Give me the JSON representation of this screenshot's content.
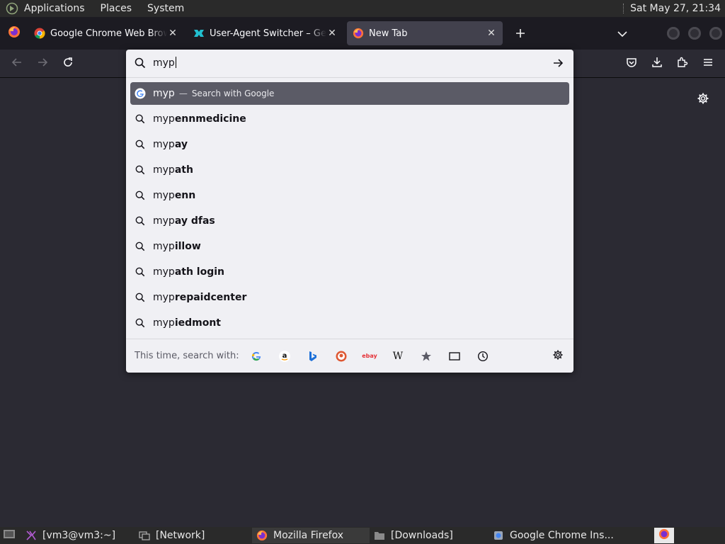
{
  "topbar": {
    "menus": [
      "Applications",
      "Places",
      "System"
    ],
    "clock": "Sat May 27, 21:34"
  },
  "tabs": [
    {
      "title": "Google Chrome Web Browser",
      "icon": "chrome-icon"
    },
    {
      "title": "User-Agent Switcher – Get this Extension for Firefox",
      "icon": "extension-icon"
    },
    {
      "title": "New Tab",
      "icon": "firefox-icon"
    }
  ],
  "urlbar": {
    "value": "myp"
  },
  "suggestions": [
    {
      "prefix": "myp",
      "rest": "",
      "dash": "—",
      "action": "Search with Google",
      "icon": "google-icon"
    },
    {
      "prefix": "myp",
      "rest": "ennmedicine"
    },
    {
      "prefix": "myp",
      "rest": "ay"
    },
    {
      "prefix": "myp",
      "rest": "ath"
    },
    {
      "prefix": "myp",
      "rest": "enn"
    },
    {
      "prefix": "myp",
      "rest": "ay dfas"
    },
    {
      "prefix": "myp",
      "rest": "illow"
    },
    {
      "prefix": "myp",
      "rest": "ath login"
    },
    {
      "prefix": "myp",
      "rest": "repaidcenter"
    },
    {
      "prefix": "myp",
      "rest": "iedmont"
    }
  ],
  "oneoff": {
    "label": "This time, search with:",
    "engines": [
      "google-icon",
      "amazon-icon",
      "bing-icon",
      "duckduckgo-icon",
      "ebay-icon",
      "wikipedia-icon",
      "bookmarks-icon",
      "tabs-icon",
      "history-icon"
    ],
    "wikipedia_glyph": "W",
    "ebay_glyph": "ebay",
    "amazon_glyph": "a"
  },
  "taskbar": {
    "items": [
      {
        "label": "[vm3@vm3:~]",
        "icon": "terminal-icon"
      },
      {
        "label": "[Network]",
        "icon": "network-icon"
      },
      {
        "label": "Mozilla Firefox",
        "icon": "firefox-icon"
      },
      {
        "label": "[Downloads]",
        "icon": "folder-icon"
      },
      {
        "label": "Google Chrome Ins...",
        "icon": "installer-icon"
      }
    ]
  },
  "colors": {
    "accent": "#5b5b66",
    "panel": "#f0f0f4",
    "toolbar": "#2b2a33",
    "tabstrip": "#1c1b22"
  }
}
